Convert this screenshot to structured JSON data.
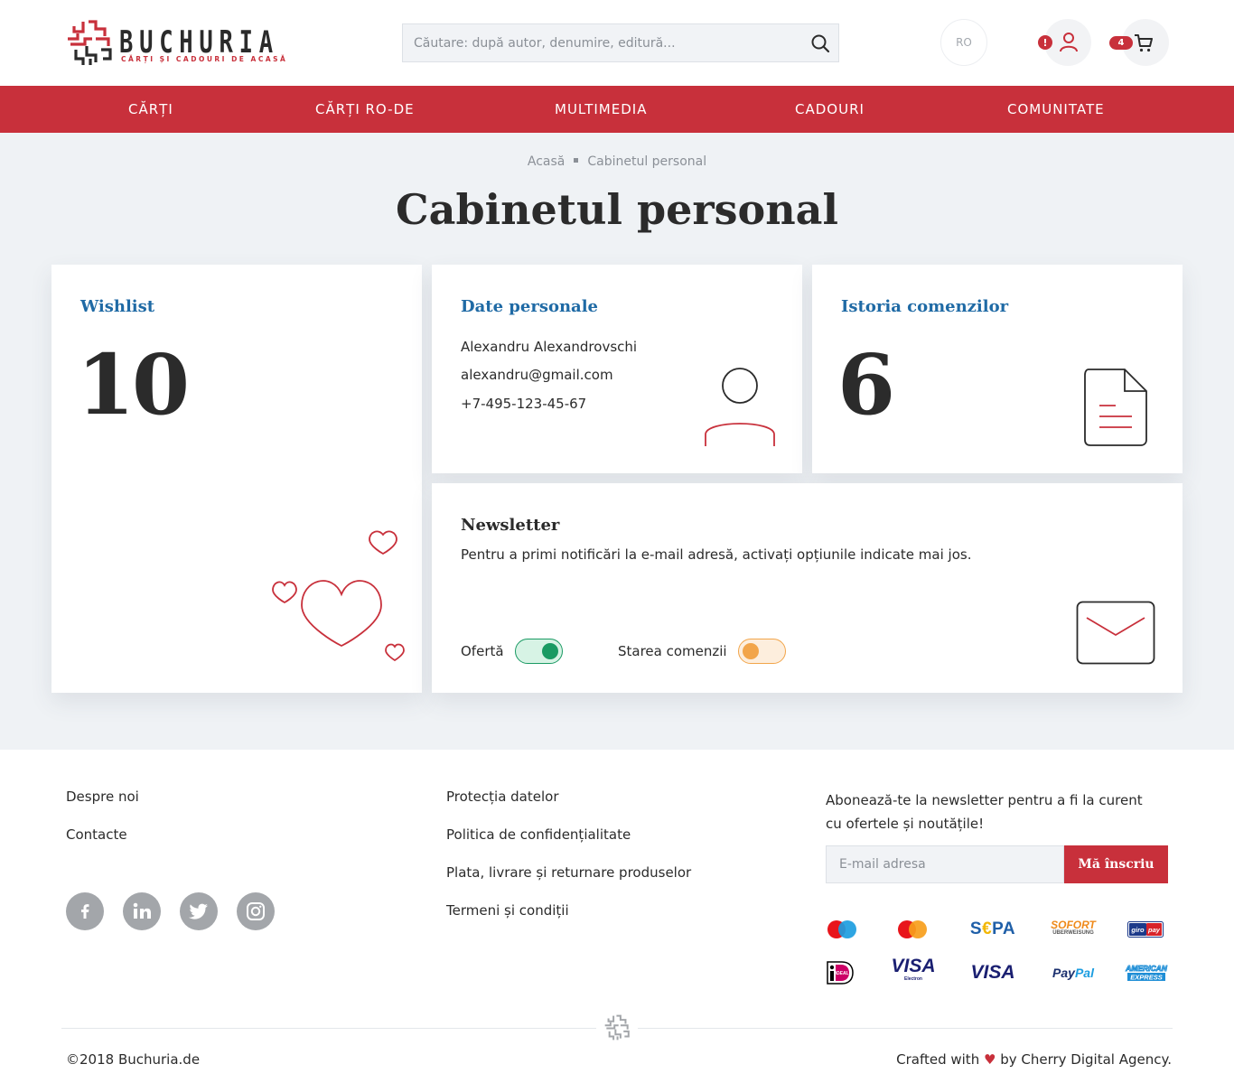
{
  "brand": {
    "name": "BUCHURIA",
    "tagline": "CĂRȚI ȘI CADOURI DE ACASĂ",
    "accent_color": "#c8303b"
  },
  "header": {
    "search_placeholder": "Căutare: după autor, denumire, editură...",
    "language": "RO",
    "alert_badge": "!",
    "cart_count": "4"
  },
  "nav": {
    "items": [
      {
        "label": "CĂRȚI"
      },
      {
        "label": "CĂRȚI RO-DE"
      },
      {
        "label": "MULTIMEDIA"
      },
      {
        "label": "CADOURI"
      },
      {
        "label": "COMUNITATE"
      }
    ]
  },
  "breadcrumb": {
    "home": "Acasă",
    "current": "Cabinetul personal"
  },
  "page_title": "Cabinetul personal",
  "cards": {
    "wishlist": {
      "title": "Wishlist",
      "count": "10"
    },
    "personal": {
      "title": "Date personale",
      "name": "Alexandru Alexandrovschi",
      "email": "alexandru@gmail.com",
      "phone": "+7-495-123-45-67"
    },
    "orders": {
      "title": "Istoria comenzilor",
      "count": "6"
    },
    "newsletter": {
      "title": "Newsletter",
      "description": "Pentru a primi notificări la e-mail adresă, activați opțiunile indicate mai jos.",
      "toggles": [
        {
          "label": "Ofertă",
          "state": "on",
          "color": "#1a9a63"
        },
        {
          "label": "Starea comenzii",
          "state": "off",
          "color": "#f2a54a"
        }
      ]
    }
  },
  "footer": {
    "col1": [
      "Despre noi",
      "Contacte"
    ],
    "col2": [
      "Protecția datelor",
      "Politica de confidențialitate",
      "Plata, livrare și returnare produselor",
      "Termeni și condiții"
    ],
    "social": [
      "facebook-icon",
      "linkedin-icon",
      "twitter-icon",
      "instagram-icon"
    ],
    "subscribe_text": "Abonează-te la newsletter pentru a fi la curent cu ofertele și noutățile!",
    "email_placeholder": "E-mail adresa",
    "subscribe_button": "Mă înscriu",
    "payments": [
      "Maestro",
      "Mastercard",
      "SEPA",
      "SOFORT ÜBERWEISUNG",
      "giropay",
      "iDEAL",
      "VISA Electron",
      "VISA",
      "PayPal",
      "AMERICAN EXPRESS"
    ],
    "copyright": "©2018 Buchuria.de",
    "crafted_prefix": "Crafted with",
    "crafted_suffix": "by Cherry Digital Agency."
  }
}
